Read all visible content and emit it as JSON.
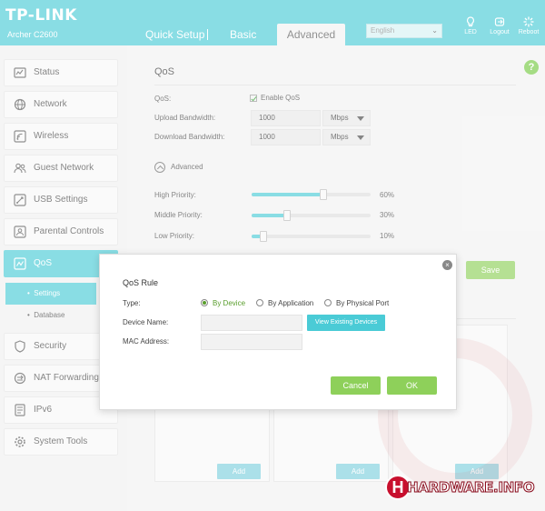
{
  "header": {
    "brand": "TP-LINK",
    "model": "Archer C2600",
    "tabs": [
      "Quick Setup",
      "Basic",
      "Advanced"
    ],
    "language": "English",
    "buttons": [
      "LED",
      "Logout",
      "Reboot"
    ]
  },
  "sidebar": {
    "items": [
      "Status",
      "Network",
      "Wireless",
      "Guest Network",
      "USB Settings",
      "Parental Controls",
      "QoS",
      "Security",
      "NAT Forwarding",
      "IPv6",
      "System Tools"
    ],
    "sub_items": [
      "Settings",
      "Database"
    ],
    "active_item": "QoS",
    "active_sub": "Settings"
  },
  "main": {
    "title": "QoS",
    "qos_label": "QoS:",
    "enable_label": "Enable QoS",
    "upload_label": "Upload Bandwidth:",
    "upload_value": "1000",
    "upload_unit": "Mbps",
    "download_label": "Download Bandwidth:",
    "download_value": "1000",
    "download_unit": "Mbps",
    "advanced_label": "Advanced",
    "priorities": [
      {
        "label": "High Priority:",
        "value": "60%",
        "fraction": 0.6
      },
      {
        "label": "Middle Priority:",
        "value": "30%",
        "fraction": 0.3
      },
      {
        "label": "Low Priority:",
        "value": "10%",
        "fraction": 0.1
      }
    ],
    "save_label": "Save",
    "add_label": "Add"
  },
  "modal": {
    "title": "QoS Rule",
    "type_label": "Type:",
    "type_options": [
      "By Device",
      "By Application",
      "By Physical Port"
    ],
    "selected_type": "By Device",
    "device_name_label": "Device Name:",
    "device_name_value": "",
    "mac_label": "MAC Address:",
    "mac_value": "",
    "view_devices_label": "View Existing Devices",
    "cancel_label": "Cancel",
    "ok_label": "OK"
  },
  "watermark": {
    "logo_letter": "H",
    "text": "HARDWARE.INFO"
  },
  "colors": {
    "header": "#4acbd6",
    "accent": "#4acbd6",
    "button_green": "#8ed05a",
    "check_green": "#5a9e2d",
    "watermark_red": "#c8102e"
  }
}
